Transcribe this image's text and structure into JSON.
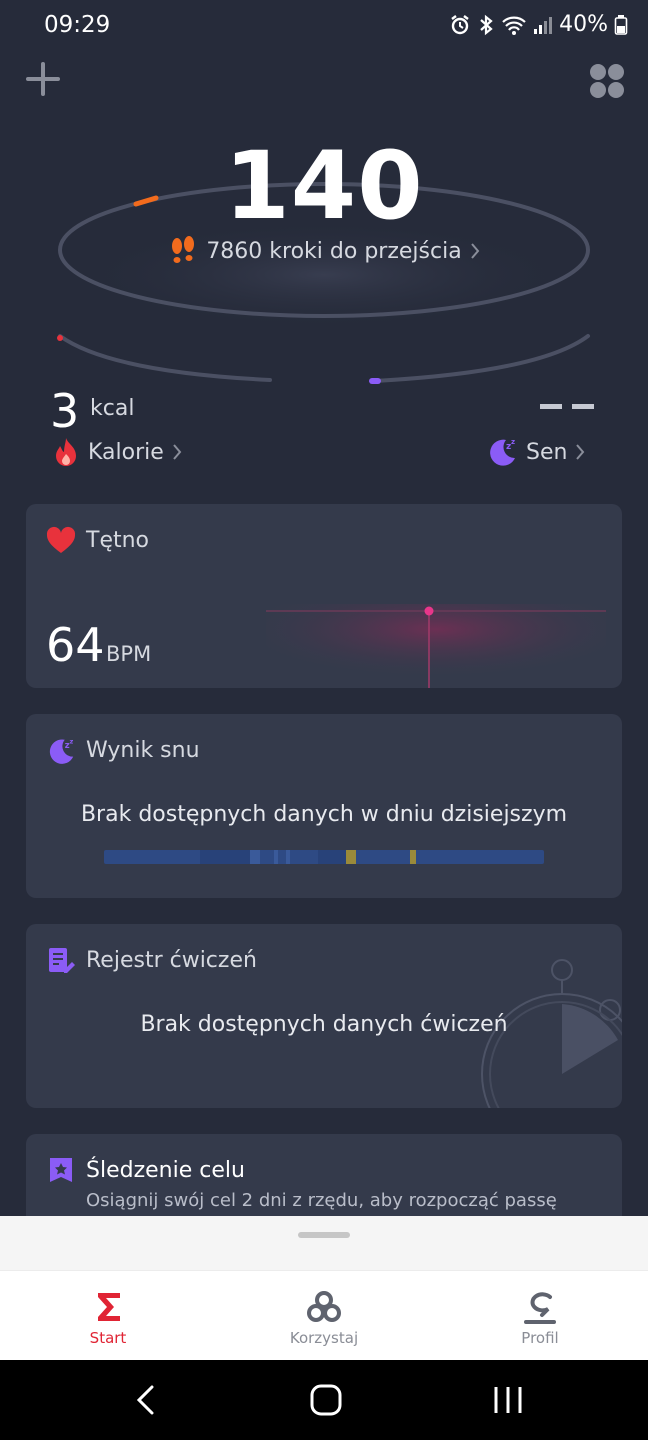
{
  "status": {
    "time": "09:29",
    "battery": "40%",
    "icons": [
      "alarm-icon",
      "bluetooth-icon",
      "wifi-icon",
      "signal-icon",
      "battery-icon"
    ]
  },
  "hero": {
    "steps": "140",
    "steps_remaining": "7860 kroki do przejścia",
    "progress_fraction": 0.014
  },
  "calories": {
    "value": "3",
    "unit": "kcal",
    "label": "Kalorie"
  },
  "sleep_summary": {
    "value": "– –",
    "label": "Sen"
  },
  "heart_card": {
    "title": "Tętno",
    "value": "64",
    "unit": "BPM"
  },
  "sleep_card": {
    "title": "Wynik snu",
    "empty_text": "Brak dostępnych danych w dniu dzisiejszym"
  },
  "exercise_card": {
    "title": "Rejestr ćwiczeń",
    "empty_text": "Brak dostępnych danych ćwiczeń"
  },
  "goal_card": {
    "title": "Śledzenie celu",
    "description": "Osiągnij swój cel 2 dni z rzędu, aby rozpocząć passę"
  },
  "nav": {
    "items": [
      {
        "label": "Start",
        "active": true
      },
      {
        "label": "Korzystaj",
        "active": false
      },
      {
        "label": "Profil",
        "active": false
      }
    ]
  },
  "colors": {
    "accent_red": "#e02434",
    "steps_orange": "#f26b1d",
    "sleep_purple": "#8b5cf6",
    "heart_red": "#e8323c",
    "background": "#262b3a",
    "card": "#343a4b"
  }
}
